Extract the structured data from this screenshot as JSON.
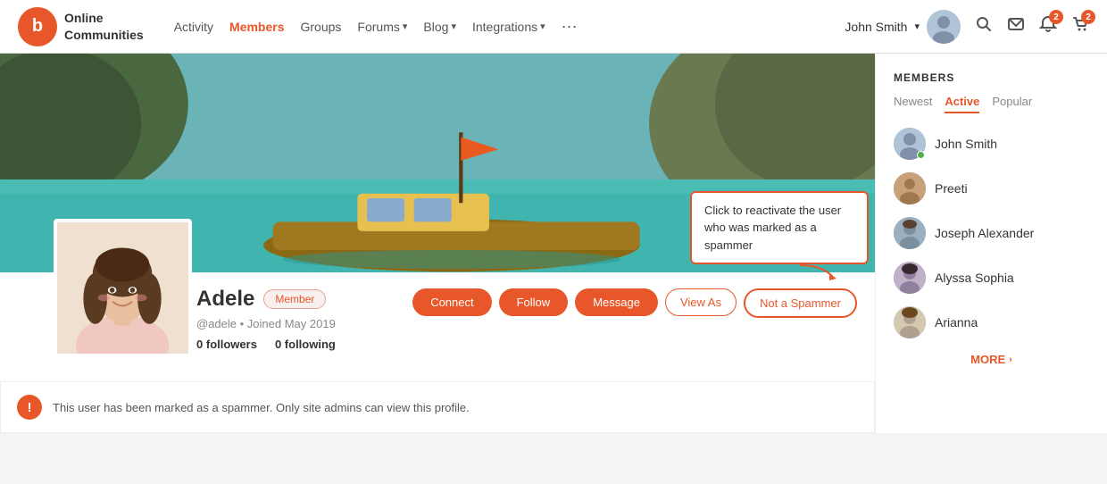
{
  "brand": {
    "logo_letter": "b",
    "name_line1": "Online",
    "name_line2": "Communities"
  },
  "nav": {
    "links": [
      {
        "label": "Activity",
        "active": false
      },
      {
        "label": "Members",
        "active": true
      },
      {
        "label": "Groups",
        "active": false
      },
      {
        "label": "Forums",
        "active": false,
        "has_dropdown": true
      },
      {
        "label": "Blog",
        "active": false,
        "has_dropdown": true
      },
      {
        "label": "Integrations",
        "active": false,
        "has_dropdown": true
      }
    ],
    "more_label": "···",
    "user_name": "John Smith",
    "notifications_count": "2",
    "cart_count": "2"
  },
  "profile": {
    "name": "Adele",
    "badge": "Member",
    "handle": "@adele",
    "joined": "Joined May 2019",
    "followers": "0",
    "following": "0",
    "followers_label": "followers",
    "following_label": "following"
  },
  "actions": {
    "connect": "Connect",
    "follow": "Follow",
    "message": "Message",
    "view_as": "View As",
    "not_spammer": "Not a Spammer",
    "callout_text": "Click to reactivate the user who was marked as a spammer"
  },
  "spammer_notice": {
    "text": "This user has been marked as a spammer. Only site admins can view this profile."
  },
  "sidebar": {
    "title": "MEMBERS",
    "tabs": [
      {
        "label": "Newest",
        "active": false
      },
      {
        "label": "Active",
        "active": true
      },
      {
        "label": "Popular",
        "active": false
      }
    ],
    "members": [
      {
        "name": "John Smith",
        "online": true,
        "color_class": "av-john"
      },
      {
        "name": "Preeti",
        "online": false,
        "color_class": "av-preeti"
      },
      {
        "name": "Joseph Alexander",
        "online": false,
        "color_class": "av-joseph"
      },
      {
        "name": "Alyssa Sophia",
        "online": false,
        "color_class": "av-alyssa"
      },
      {
        "name": "Arianna",
        "online": false,
        "color_class": "av-arianna"
      }
    ],
    "more_label": "MORE"
  }
}
